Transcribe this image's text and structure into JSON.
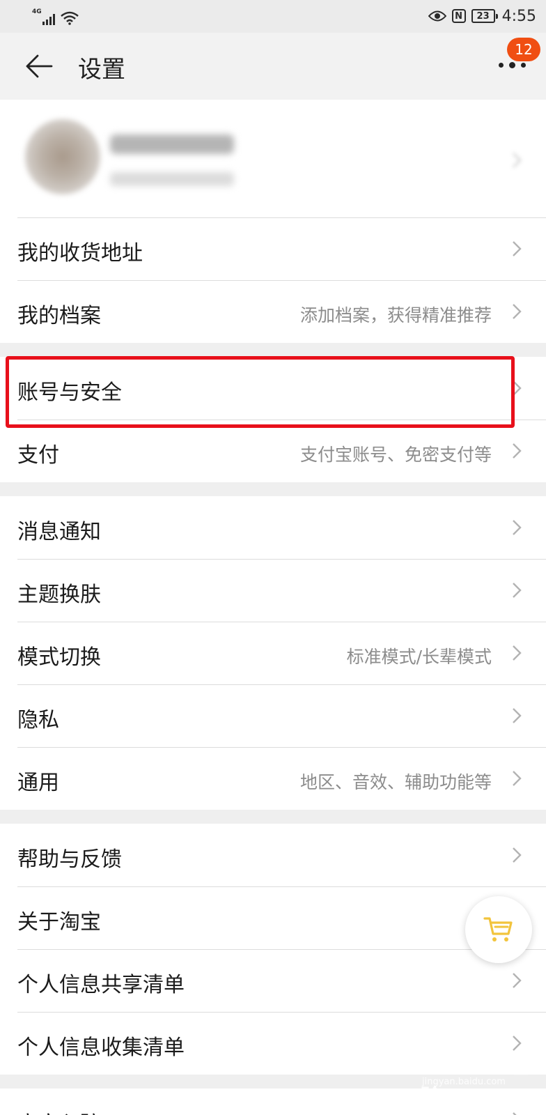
{
  "status_bar": {
    "network": "4G",
    "battery": "23",
    "time": "4:55",
    "nfc_label": "N"
  },
  "nav": {
    "title": "设置",
    "badge_count": "12"
  },
  "profile": {
    "name": "████████",
    "subtitle": "████████"
  },
  "groups": [
    {
      "items": [
        {
          "label": "我的收货地址",
          "hint": ""
        },
        {
          "label": "我的档案",
          "hint": "添加档案，获得精准推荐"
        }
      ]
    },
    {
      "items": [
        {
          "label": "账号与安全",
          "hint": ""
        },
        {
          "label": "支付",
          "hint": "支付宝账号、免密支付等"
        }
      ]
    },
    {
      "items": [
        {
          "label": "消息通知",
          "hint": ""
        },
        {
          "label": "主题换肤",
          "hint": ""
        },
        {
          "label": "模式切换",
          "hint": "标准模式/长辈模式"
        },
        {
          "label": "隐私",
          "hint": ""
        },
        {
          "label": "通用",
          "hint": "地区、音效、辅助功能等"
        }
      ]
    },
    {
      "items": [
        {
          "label": "帮助与反馈",
          "hint": ""
        },
        {
          "label": "关于淘宝",
          "hint": ""
        },
        {
          "label": "个人信息共享清单",
          "hint": ""
        },
        {
          "label": "个人信息收集清单",
          "hint": ""
        }
      ]
    },
    {
      "items": [
        {
          "label": "商家入驻",
          "hint": ""
        }
      ]
    }
  ],
  "watermark": {
    "text": "Bai du 经验",
    "sub": "jingyan.baidu.com"
  },
  "colors": {
    "badge": "#f04e12",
    "highlight_box": "#e8101b",
    "cart_icon": "#f2c43c"
  }
}
